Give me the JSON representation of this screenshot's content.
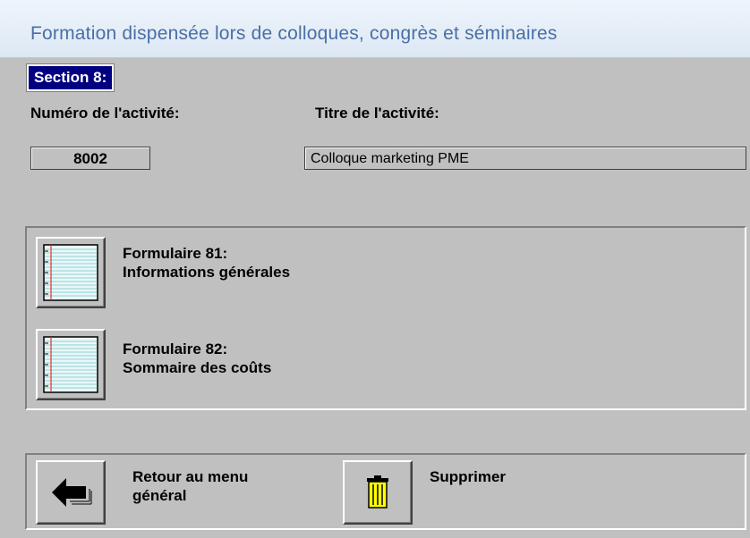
{
  "window": {
    "title": "Formation dispensée lors de colloques, congrès et séminaires"
  },
  "section": {
    "label": "Section 8:"
  },
  "activity": {
    "number_label": "Numéro de l'activité:",
    "number_value": "8002",
    "title_label": "Titre de l'activité:",
    "title_value": "Colloque marketing PME"
  },
  "forms": [
    {
      "line1": "Formulaire 81:",
      "line2": "Informations générales",
      "icon": "notepad-icon"
    },
    {
      "line1": "Formulaire 82:",
      "line2": "Sommaire des coûts",
      "icon": "notepad-icon"
    }
  ],
  "actions": {
    "back": {
      "line1": "Retour au menu",
      "line2": "général",
      "icon": "back-arrow-icon"
    },
    "delete": {
      "label": "Supprimer",
      "icon": "trash-icon"
    }
  },
  "colors": {
    "section_bg": "#000080",
    "title_text": "#4a6fa5",
    "window_bg": "#c0c0c0",
    "trash": "#ffff00"
  }
}
